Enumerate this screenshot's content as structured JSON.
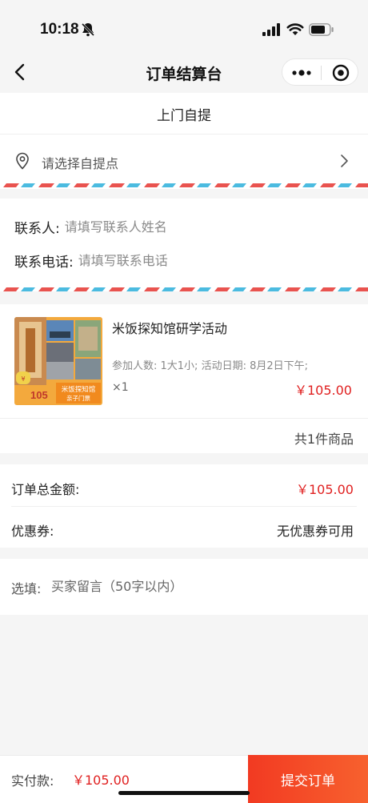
{
  "status_bar": {
    "time": "10:18"
  },
  "nav": {
    "title": "订单结算台"
  },
  "pickup": {
    "tab_label": "上门自提",
    "select_label": "请选择自提点"
  },
  "contact": {
    "name_label": "联系人:",
    "name_placeholder": "请填写联系人姓名",
    "phone_label": "联系电话:",
    "phone_placeholder": "请填写联系电话"
  },
  "product": {
    "name": "米饭探知馆研学活动",
    "spec": "参加人数: 1大1小; 活动日期: 8月2日下午;",
    "quantity": "×1",
    "price": "￥105.00",
    "count_text": "共1件商品",
    "thumb": {
      "price_badge": "105",
      "caption_line1": "米饭探知馆",
      "caption_line2": "亲子门票"
    }
  },
  "totals": {
    "order_total_label": "订单总金额:",
    "order_total_value": "￥105.00",
    "coupon_label": "优惠券:",
    "coupon_value": "无优惠券可用"
  },
  "message": {
    "label": "选填:",
    "placeholder": "买家留言（50字以内）"
  },
  "footer": {
    "pay_label": "实付款:",
    "pay_amount": "￥105.00",
    "submit_label": "提交订单"
  },
  "colors": {
    "price_red": "#e02020",
    "submit_start": "#f23a22",
    "submit_end": "#f7612e",
    "airmail_red": "#e9534f",
    "airmail_blue": "#4bbbe0"
  }
}
